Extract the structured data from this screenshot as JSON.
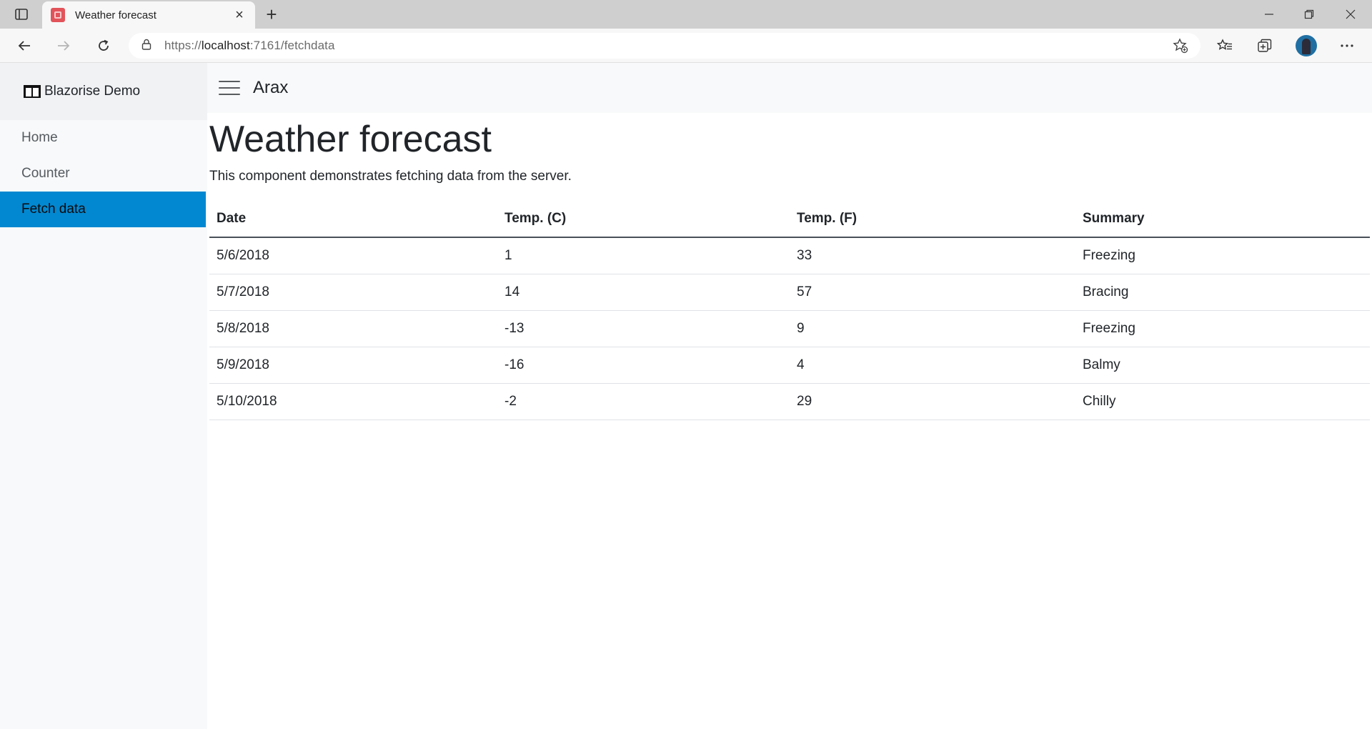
{
  "browser": {
    "tab_title": "Weather forecast",
    "url_prefix": "https://",
    "url_host": "localhost",
    "url_path": ":7161/fetchdata"
  },
  "sidebar": {
    "brand": "Blazorise Demo",
    "items": [
      {
        "label": "Home",
        "active": false
      },
      {
        "label": "Counter",
        "active": false
      },
      {
        "label": "Fetch data",
        "active": true
      }
    ]
  },
  "topbar": {
    "title": "Arax"
  },
  "page": {
    "title": "Weather forecast",
    "description": "This component demonstrates fetching data from the server."
  },
  "table": {
    "headers": [
      "Date",
      "Temp. (C)",
      "Temp. (F)",
      "Summary"
    ],
    "rows": [
      [
        "5/6/2018",
        "1",
        "33",
        "Freezing"
      ],
      [
        "5/7/2018",
        "14",
        "57",
        "Bracing"
      ],
      [
        "5/8/2018",
        "-13",
        "9",
        "Freezing"
      ],
      [
        "5/9/2018",
        "-16",
        "4",
        "Balmy"
      ],
      [
        "5/10/2018",
        "-2",
        "29",
        "Chilly"
      ]
    ]
  },
  "colors": {
    "accent": "#0288d1",
    "sidebar_bg": "#f8f9fa"
  }
}
